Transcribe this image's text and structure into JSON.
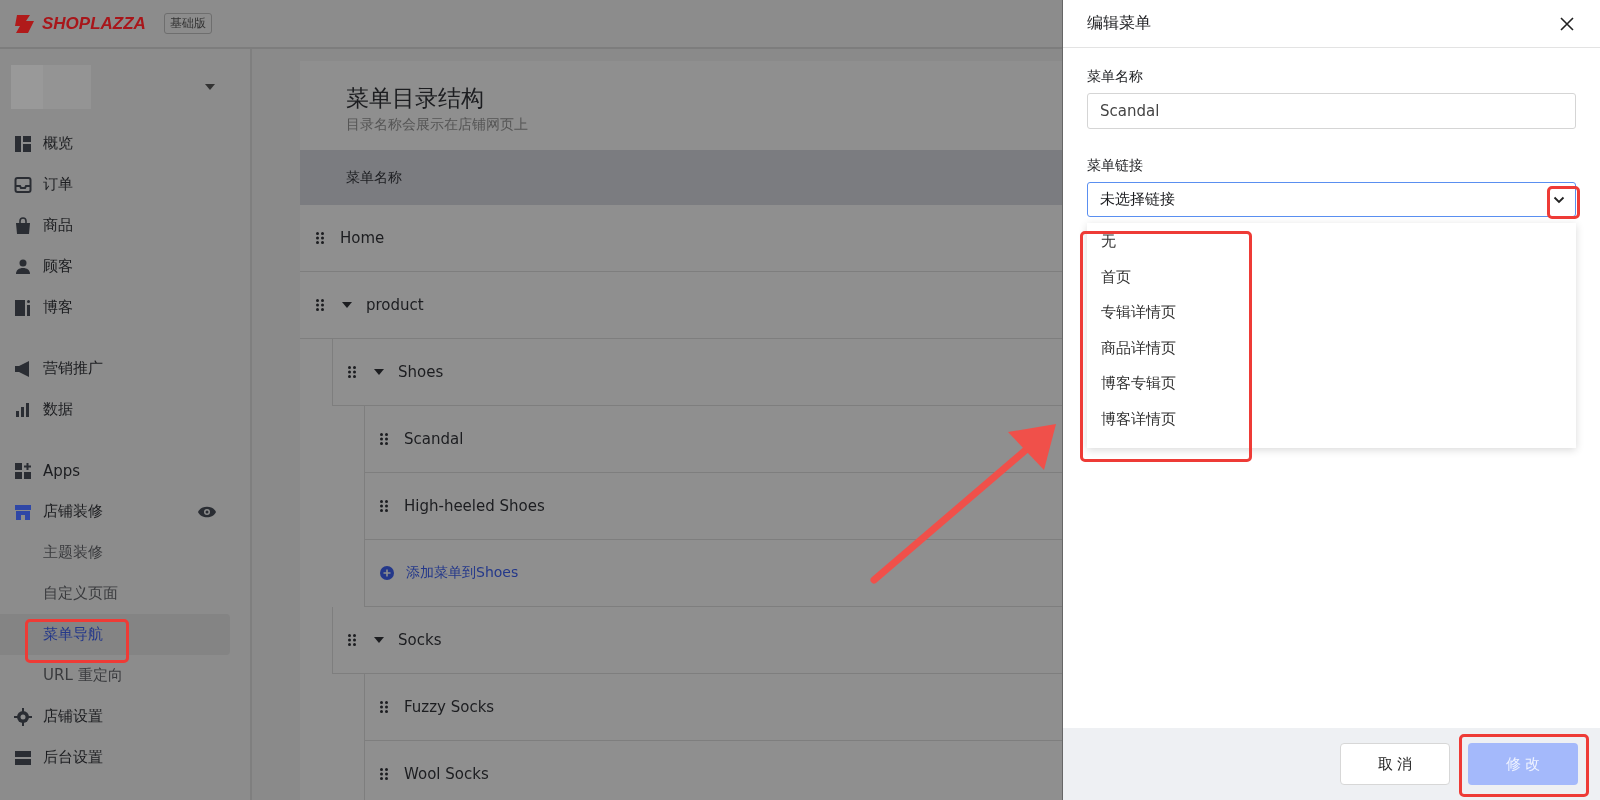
{
  "header": {
    "logo": "SHOPLAZZA",
    "plan_badge": "基础版"
  },
  "sidebar": {
    "groups": [
      [
        {
          "label": "概览"
        },
        {
          "label": "订单"
        },
        {
          "label": "商品"
        },
        {
          "label": "顾客"
        },
        {
          "label": "博客"
        }
      ],
      [
        {
          "label": "营销推广"
        },
        {
          "label": "数据"
        }
      ],
      [
        {
          "label": "Apps"
        },
        {
          "label": "店铺装修",
          "children": [
            {
              "label": "主题装修",
              "selected": false
            },
            {
              "label": "自定义页面",
              "selected": false
            },
            {
              "label": "菜单导航",
              "selected": true
            },
            {
              "label": "URL 重定向",
              "selected": false
            }
          ]
        },
        {
          "label": "店铺设置"
        },
        {
          "label": "后台设置"
        }
      ]
    ]
  },
  "menu_structure": {
    "title": "菜单目录结构",
    "subtitle": "目录名称会展示在店铺网页上",
    "column_header": "菜单名称",
    "items": [
      {
        "kind": "item",
        "label": "Home"
      },
      {
        "kind": "item",
        "label": "product",
        "expanded": true,
        "children": [
          {
            "kind": "item",
            "label": "Shoes",
            "expanded": true,
            "children": [
              {
                "kind": "item",
                "label": "Scandal"
              },
              {
                "kind": "item",
                "label": "High-heeled Shoes"
              },
              {
                "kind": "add",
                "label": "添加菜单到Shoes"
              }
            ]
          },
          {
            "kind": "item",
            "label": "Socks",
            "expanded": true,
            "children": [
              {
                "kind": "item",
                "label": "Fuzzy Socks"
              },
              {
                "kind": "item",
                "label": "Wool Socks"
              }
            ]
          }
        ]
      }
    ]
  },
  "drawer": {
    "title": "编辑菜单",
    "name_label": "菜单名称",
    "name_value": "Scandal",
    "link_label": "菜单链接",
    "link_value": "未选择链接",
    "options": [
      "无",
      "首页",
      "专辑详情页",
      "商品详情页",
      "博客专辑页",
      "博客详情页"
    ],
    "buttons": [
      {
        "label": "取 消",
        "kind": "secondary",
        "disabled": false
      },
      {
        "label": "修 改",
        "kind": "primary",
        "disabled": true
      }
    ]
  }
}
